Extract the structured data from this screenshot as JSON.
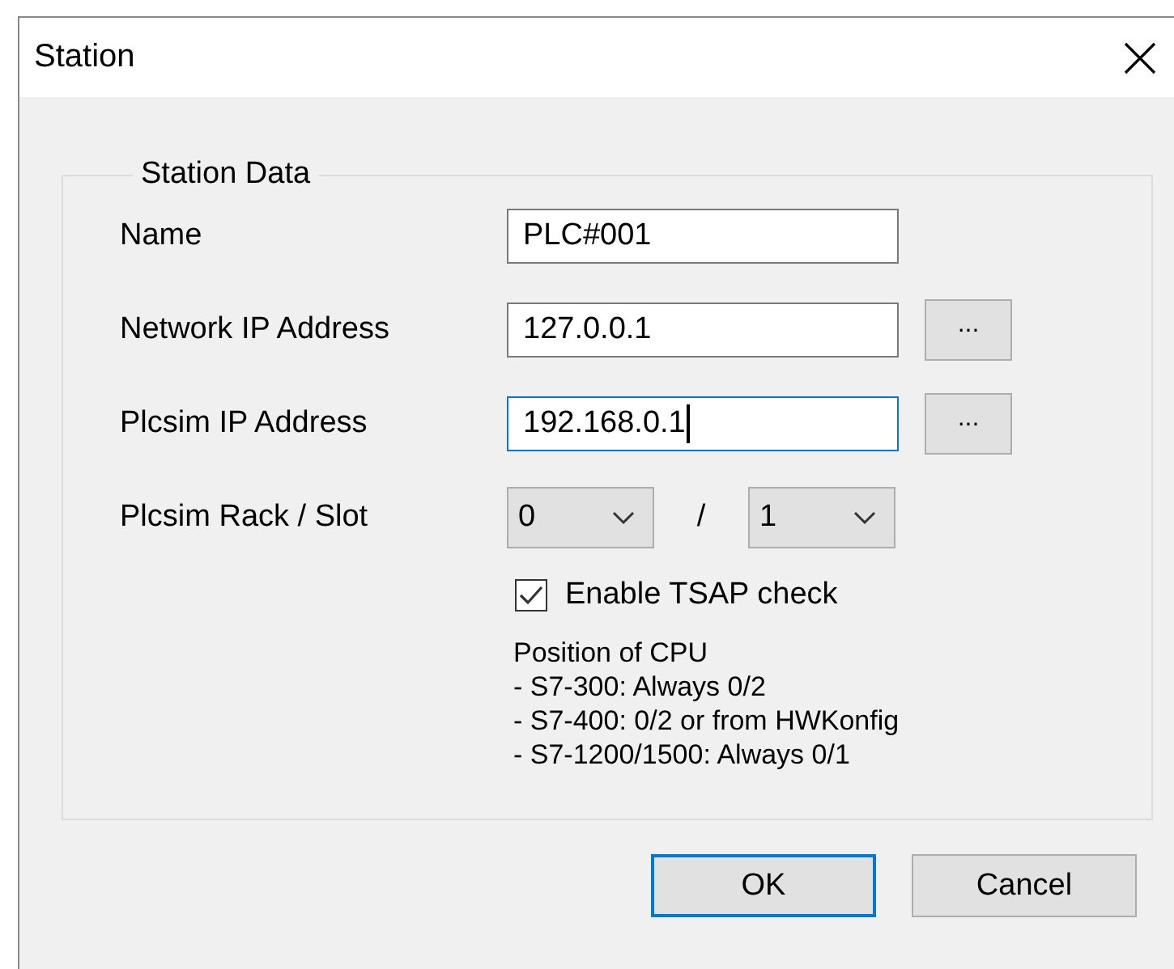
{
  "window": {
    "title": "Station"
  },
  "group": {
    "title": "Station Data",
    "rows": [
      {
        "kind": "text",
        "label": "Name",
        "value": "PLC#001",
        "focused": false
      },
      {
        "kind": "text",
        "label": "Network IP Address",
        "value": "127.0.0.1",
        "focused": false,
        "browse": "..."
      },
      {
        "kind": "text",
        "label": "Plcsim IP Address",
        "value": "192.168.0.1",
        "focused": true,
        "browse": "..."
      },
      {
        "kind": "slots",
        "label": "Plcsim Rack / Slot",
        "rack": "0",
        "separator": "/",
        "slot": "1"
      }
    ],
    "checkbox": {
      "label": "Enable TSAP check",
      "checked": true
    },
    "note": [
      "Position of CPU",
      "- S7-300: Always 0/2",
      "- S7-400: 0/2 or from HWKonfig",
      "- S7-1200/1500: Always 0/1"
    ]
  },
  "buttons": [
    {
      "label": "OK",
      "default": true
    },
    {
      "label": "Cancel",
      "default": false
    }
  ]
}
